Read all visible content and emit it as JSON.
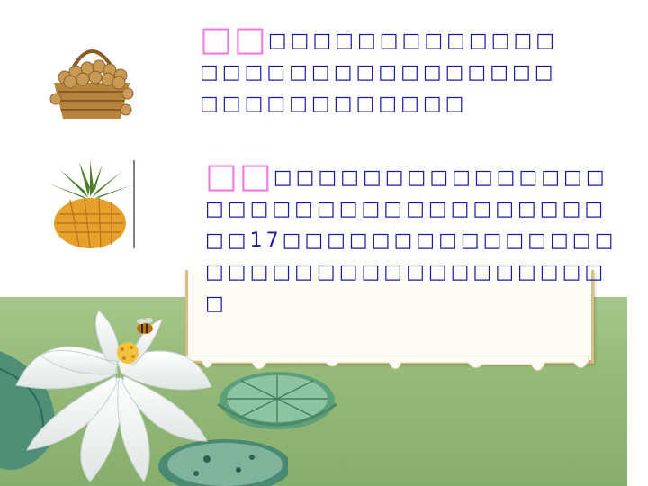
{
  "items": [
    {
      "tag": "□□",
      "text": "□□□□□□□□□□□□□□□□□□□□□□□□□□□□□□□□□□□□□□□□□",
      "image": "longan-basket",
      "image_label": "longan basket"
    },
    {
      "tag": "□□",
      "text": "□□□□□□□□□□□□□□□□□□□□□□□□□□□□□□□□□□□17□□□□□□□□□□□□□□□□□□□□□□□□□□□□□□□□□□",
      "image": "pineapple",
      "image_label": "pineapple"
    }
  ],
  "colors": {
    "text": "#1a1aa8",
    "tag": "#ee7ddc",
    "background_green": "#93b978"
  },
  "decor": [
    "white-lotus",
    "lily-pad",
    "bee",
    "paper-frame"
  ]
}
